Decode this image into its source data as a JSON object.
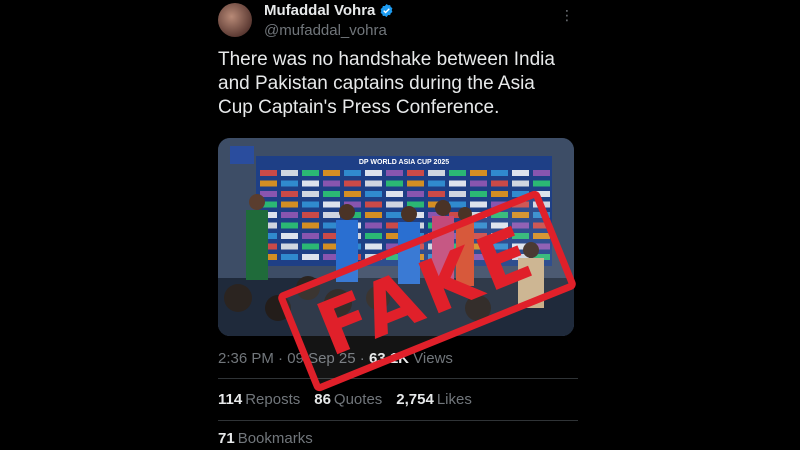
{
  "author": {
    "display_name": "Mufaddal Vohra",
    "handle": "@mufaddal_vohra",
    "verified": true
  },
  "tweet": {
    "text_lines": [
      "There was no handshake between India",
      "and Pakistan captains during the Asia",
      "Cup Captain's Press Conference."
    ]
  },
  "media": {
    "backdrop_title": "DP WORLD ASIA CUP 2025",
    "description_icon": "press-conference-photo"
  },
  "meta": {
    "time": "2:36 PM",
    "sep": "·",
    "date": "09 Sep 25",
    "views_count": "63.1K",
    "views_label": "Views"
  },
  "stats": {
    "reposts_count": "114",
    "reposts_label": "Reposts",
    "quotes_count": "86",
    "quotes_label": "Quotes",
    "likes_count": "2,754",
    "likes_label": "Likes",
    "bookmarks_count": "71",
    "bookmarks_label": "Bookmarks"
  },
  "stamp": {
    "text": "FAKE",
    "color": "#e0202a"
  },
  "colors": {
    "verified": "#1d9bf0",
    "text": "#e7e9ea",
    "muted": "#71767b",
    "bg": "#000000"
  }
}
